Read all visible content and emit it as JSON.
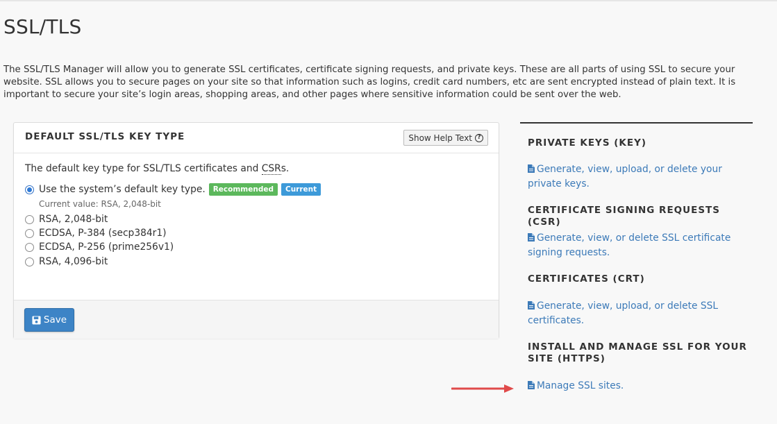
{
  "page": {
    "title": "SSL/TLS",
    "intro": "The SSL/TLS Manager will allow you to generate SSL certificates, certificate signing requests, and private keys. These are all parts of using SSL to secure your website. SSL allows you to secure pages on your site so that information such as logins, credit card numbers, etc are sent encrypted instead of plain text. It is important to secure your site’s login areas, shopping areas, and other pages where sensitive information could be sent over the web."
  },
  "panel": {
    "title": "DEFAULT SSL/TLS KEY TYPE",
    "help_button": "Show Help Text",
    "description_prefix": "The default key type for SSL/TLS certificates and ",
    "description_abbr": "CSR",
    "description_suffix": "s.",
    "options": [
      {
        "label": "Use the system’s default key type.",
        "checked": true
      },
      {
        "label": "RSA, 2,048-bit",
        "checked": false
      },
      {
        "label": "ECDSA, P-384 (secp384r1)",
        "checked": false
      },
      {
        "label": "ECDSA, P-256 (prime256v1)",
        "checked": false
      },
      {
        "label": "RSA, 4,096-bit",
        "checked": false
      }
    ],
    "badges": {
      "recommended": "Recommended",
      "current": "Current"
    },
    "current_value": "Current value: RSA, 2,048-bit",
    "save_label": "Save"
  },
  "sidebar": {
    "sections": [
      {
        "heading": "PRIVATE KEYS (KEY)",
        "link": "Generate, view, upload, or delete your private keys."
      },
      {
        "heading": "CERTIFICATE SIGNING REQUESTS (CSR)",
        "link": "Generate, view, or delete SSL certificate signing requests."
      },
      {
        "heading": "CERTIFICATES (CRT)",
        "link": "Generate, view, upload, or delete SSL certificates."
      },
      {
        "heading": "INSTALL AND MANAGE SSL FOR YOUR SITE (HTTPS)",
        "link": "Manage SSL sites."
      }
    ]
  },
  "colors": {
    "link": "#3c7ab8",
    "primary_button": "#3d84c6",
    "badge_recommended": "#5cb85c",
    "badge_current": "#3d9ad9",
    "annotation_arrow": "#e04a4a"
  },
  "icons": [
    "question-circle-icon",
    "save-icon",
    "file-icon",
    "arrow-annotation"
  ]
}
